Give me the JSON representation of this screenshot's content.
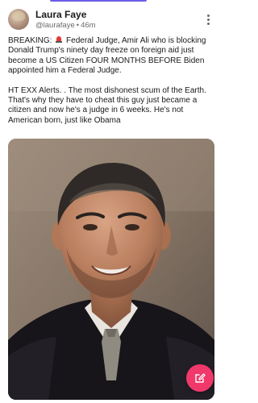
{
  "post": {
    "author": {
      "display_name": "Laura Faye",
      "handle": "@laurafaye",
      "time_ago": "46m"
    },
    "paragraphs": [
      {
        "before": "BREAKING: ",
        "emoji": "rotating-light-icon",
        "after": " Federal Judge, Amir Ali who is blocking Donald Trump's ninety day freeze on foreign aid just become a US Citizen FOUR MONTHS BEFORE Biden appointed him a Federal Judge."
      },
      {
        "text": "HT EXX Alerts. . The most dishonest scum of the Earth. That's why they have to cheat this guy just became a citizen and now he's a judge in 6 weeks. He's not American born, just like Obama"
      }
    ],
    "image": {
      "subject": "portrait-photo"
    }
  },
  "colors": {
    "accent": "#6c5ce7",
    "fab": "#f0386b",
    "text_primary": "#1a1a1a",
    "text_secondary": "#6b6b6b"
  },
  "icons": {
    "more": "more-vertical-icon",
    "compose": "edit-icon",
    "alarm": "rotating-light-icon"
  }
}
